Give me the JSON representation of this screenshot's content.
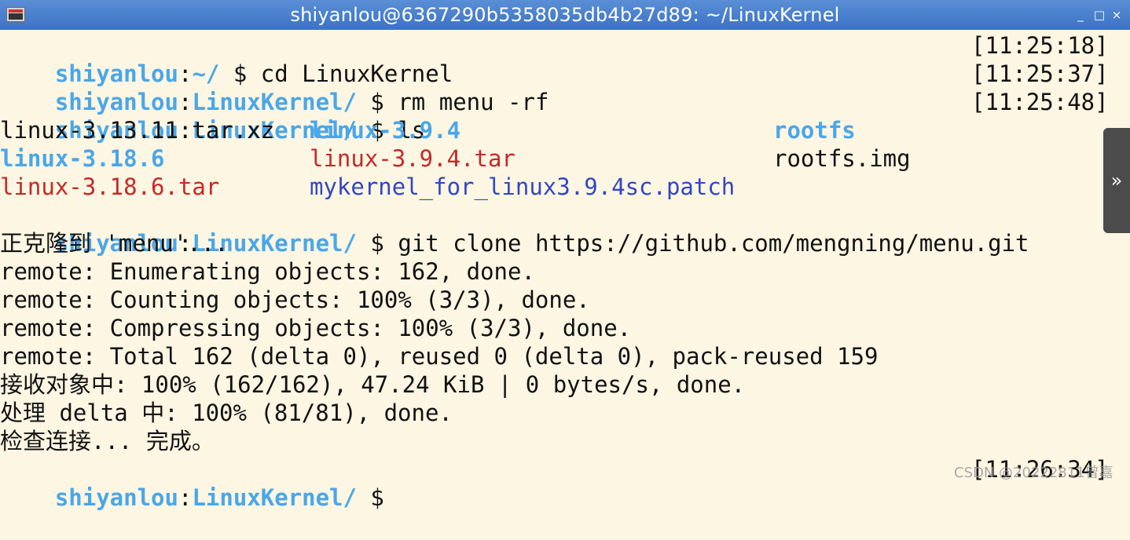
{
  "window": {
    "title": "shiyanlou@6367290b5358035db4b27d89: ~/LinuxKernel",
    "minimize": "_",
    "maximize": "□",
    "close": "×"
  },
  "terminal": {
    "prompt_user": "shiyanlou",
    "colon": ":",
    "home_path": "~/",
    "path": "LinuxKernel/",
    "dollar": " $",
    "cmd_1": " cd LinuxKernel",
    "cmd_2": " rm menu -rf",
    "cmd_3": " ls",
    "cmd_4": " git clone https://github.com/mengning/menu.git",
    "ts_1": "[11:25:18]",
    "ts_2": "[11:25:37]",
    "ts_3": "[11:25:48]",
    "ts_4": "[11:26:34]",
    "ls": {
      "f1": "linux-3.13.11.tar.xz",
      "f2": "linux-3.9.4",
      "f3": "rootfs",
      "f4": "linux-3.18.6",
      "f5": "linux-3.9.4.tar",
      "f6": "rootfs.img",
      "f7": "linux-3.18.6.tar",
      "f8": "mykernel_for_linux3.9.4sc.patch"
    },
    "out_1": "正克隆到 'menu'...",
    "out_2": "remote: Enumerating objects: 162, done.",
    "out_3": "remote: Counting objects: 100% (3/3), done.",
    "out_4": "remote: Compressing objects: 100% (3/3), done.",
    "out_5": "remote: Total 162 (delta 0), reused 0 (delta 0), pack-reused 159",
    "out_6": "接收对象中: 100% (162/162), 47.24 KiB | 0 bytes/s, done.",
    "out_7": "处理 delta 中: 100% (81/81), done.",
    "out_8": "检查连接... 完成。"
  },
  "sidebar": {
    "toggle": "»"
  },
  "watermark": "CSDN @20222811曾嘉"
}
